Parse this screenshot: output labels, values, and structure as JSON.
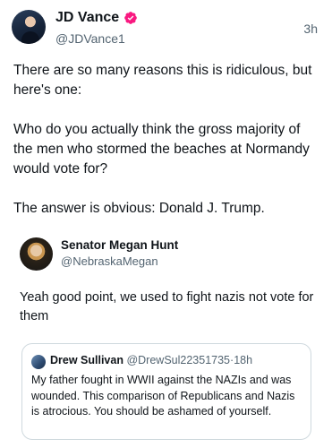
{
  "tweet": {
    "author_name": "JD Vance",
    "handle": "@JDVance1",
    "timestamp": "3h",
    "paragraphs": [
      "There are so many reasons this is ridiculous, but here's one:",
      "Who do you actually think the gross majority of the men who stormed the beaches at Normandy would vote for?",
      "The answer is obvious: Donald J. Trump."
    ]
  },
  "embedded_post": {
    "author_name": "Senator Megan Hunt",
    "handle": "@NebraskaMegan",
    "text": "Yeah good point, we used to fight nazis not vote for them"
  },
  "quoted_post": {
    "author_name": "Drew Sullivan",
    "handle": "@DrewSul22351735",
    "separator": "·",
    "timestamp": "18h",
    "text": "My father fought in WWII against the NAZIs and was wounded. This comparison of Republicans and Nazis is atrocious.  You should be ashamed of yourself."
  },
  "colors": {
    "verified_badge": "#f91880",
    "secondary_text": "#536471",
    "primary_text": "#0f1419",
    "card_border": "#cfd9de"
  },
  "icons": {
    "verified": "verified-badge-icon"
  }
}
